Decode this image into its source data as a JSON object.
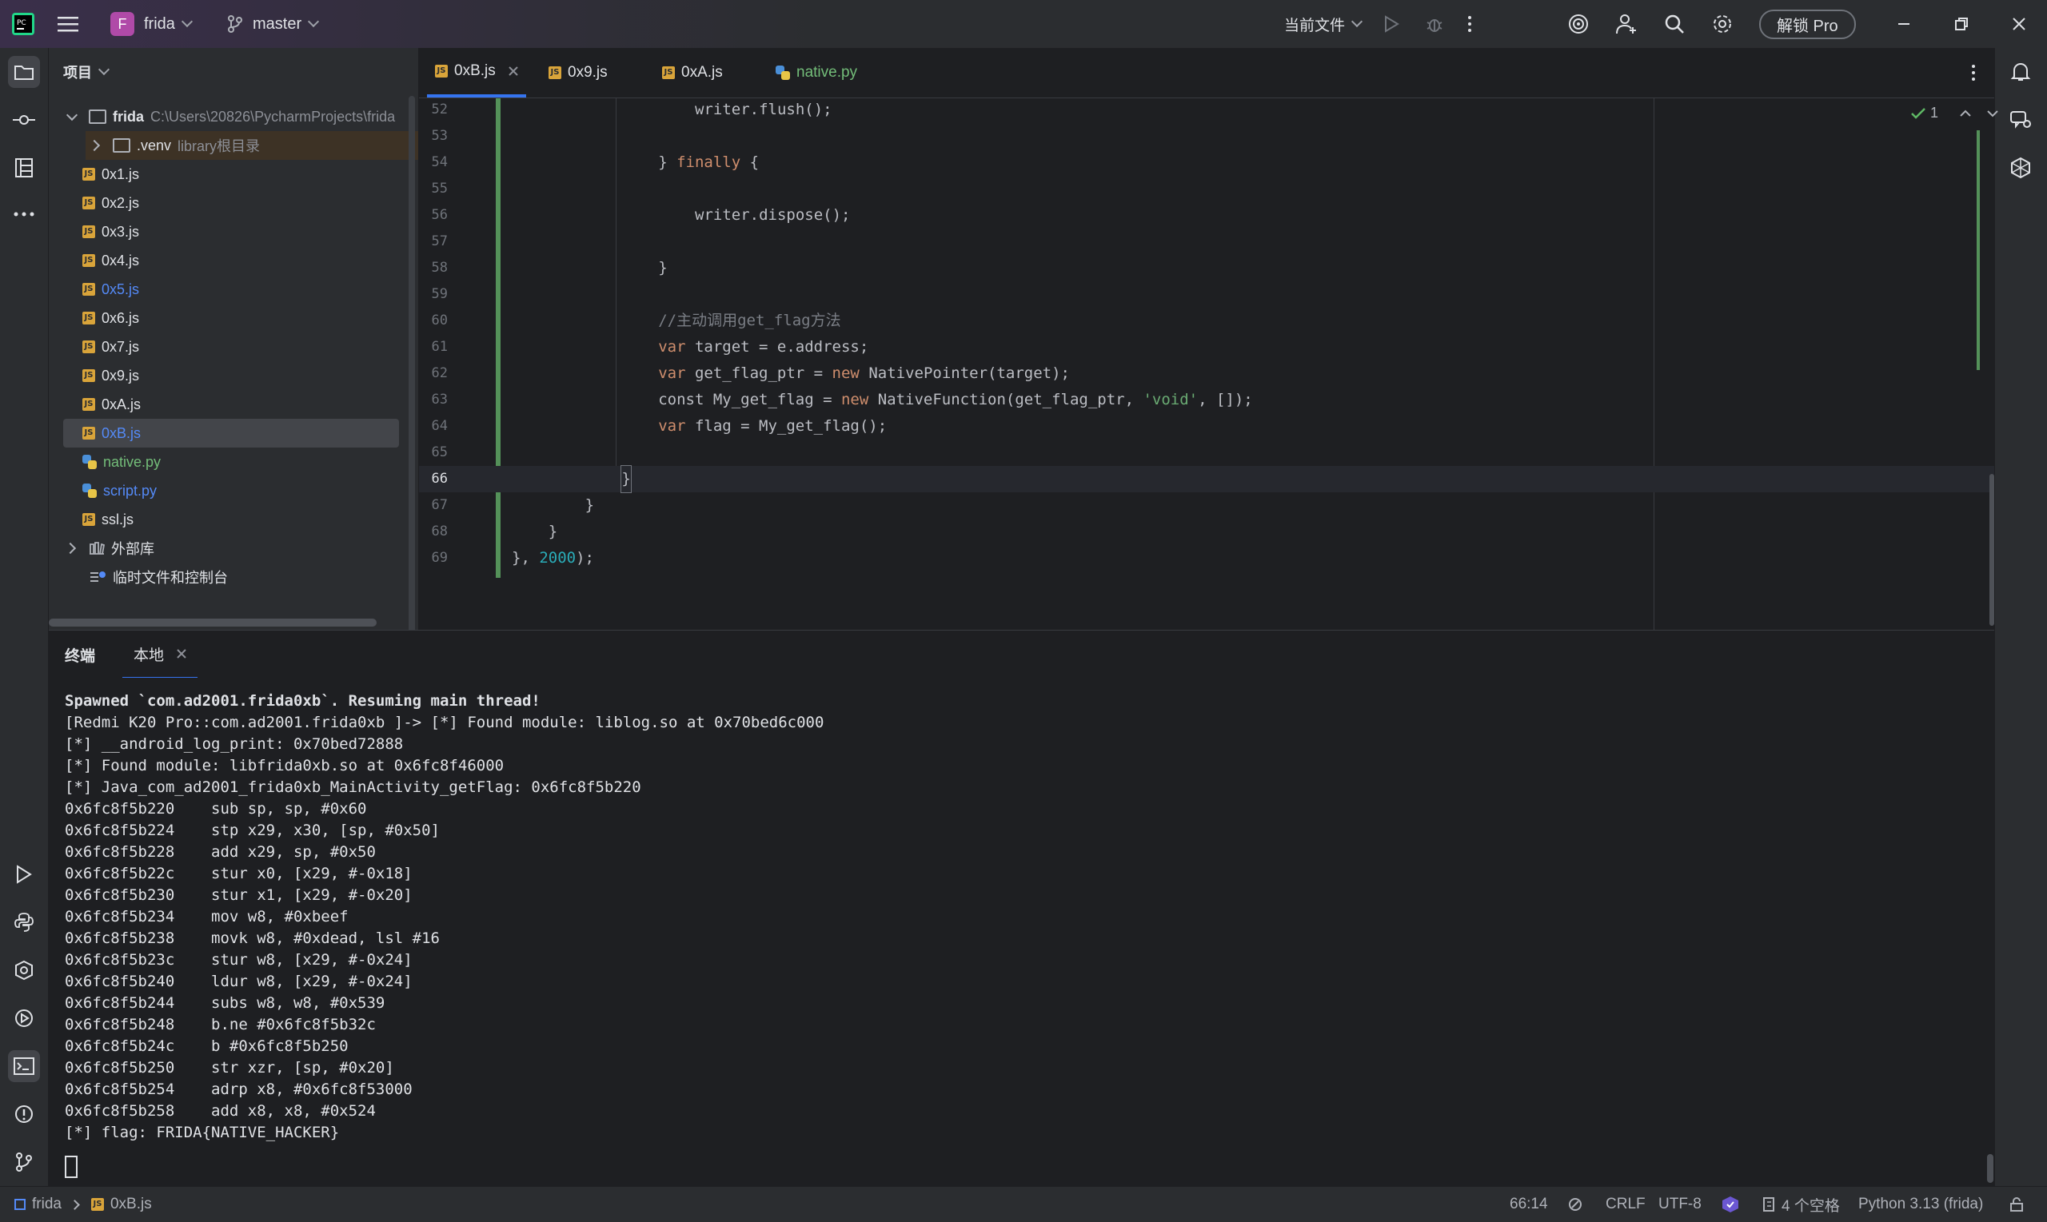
{
  "titlebar": {
    "project_letter": "F",
    "project_name": "frida",
    "branch": "master",
    "run_config": "当前文件",
    "unlock_label": "解锁 Pro"
  },
  "project_panel": {
    "header": "项目",
    "root_name": "frida",
    "root_path": "C:\\Users\\20826\\PycharmProjects\\frida",
    "items": [
      {
        "label": ".venv",
        "hint": "library根目录",
        "type": "folder"
      },
      {
        "label": "0x1.js",
        "type": "js"
      },
      {
        "label": "0x2.js",
        "type": "js"
      },
      {
        "label": "0x3.js",
        "type": "js"
      },
      {
        "label": "0x4.js",
        "type": "js"
      },
      {
        "label": "0x5.js",
        "type": "js",
        "color": "#548af7"
      },
      {
        "label": "0x6.js",
        "type": "js"
      },
      {
        "label": "0x7.js",
        "type": "js"
      },
      {
        "label": "0x9.js",
        "type": "js"
      },
      {
        "label": "0xA.js",
        "type": "js"
      },
      {
        "label": "0xB.js",
        "type": "js",
        "color": "#548af7",
        "selected": true
      },
      {
        "label": "native.py",
        "type": "py",
        "color": "#73bd79"
      },
      {
        "label": "script.py",
        "type": "py",
        "color": "#548af7"
      },
      {
        "label": "ssl.js",
        "type": "js"
      }
    ],
    "external_libs": "外部库",
    "scratches": "临时文件和控制台"
  },
  "editor": {
    "tabs": [
      {
        "label": "0xB.js",
        "active": true,
        "closable": true,
        "icon": "js"
      },
      {
        "label": "0x9.js",
        "icon": "js"
      },
      {
        "label": "0xA.js",
        "icon": "js"
      },
      {
        "label": "native.py",
        "icon": "py",
        "color": "#73bd79"
      }
    ],
    "inspection_count": "1",
    "lines": [
      {
        "n": "52",
        "indent": 20,
        "parts": [
          [
            "writer.flush();",
            ""
          ]
        ]
      },
      {
        "n": "53",
        "indent": 0,
        "parts": []
      },
      {
        "n": "54",
        "indent": 16,
        "parts": [
          [
            "} ",
            ""
          ],
          [
            "finally",
            "kw"
          ],
          [
            " {",
            ""
          ]
        ]
      },
      {
        "n": "55",
        "indent": 0,
        "parts": []
      },
      {
        "n": "56",
        "indent": 20,
        "parts": [
          [
            "writer.dispose();",
            ""
          ]
        ]
      },
      {
        "n": "57",
        "indent": 0,
        "parts": []
      },
      {
        "n": "58",
        "indent": 16,
        "parts": [
          [
            "}",
            ""
          ]
        ]
      },
      {
        "n": "59",
        "indent": 0,
        "parts": []
      },
      {
        "n": "60",
        "indent": 16,
        "parts": [
          [
            "//主动调用get_flag方法",
            "cmt"
          ]
        ]
      },
      {
        "n": "61",
        "indent": 16,
        "parts": [
          [
            "var",
            "kw"
          ],
          [
            " target = e.address;",
            ""
          ]
        ]
      },
      {
        "n": "62",
        "indent": 16,
        "parts": [
          [
            "var",
            "kw"
          ],
          [
            " get_flag_ptr = ",
            ""
          ],
          [
            "new",
            "kw"
          ],
          [
            " NativePointer(target);",
            ""
          ]
        ]
      },
      {
        "n": "63",
        "indent": 16,
        "parts": [
          [
            "const My_get_flag = ",
            ""
          ],
          [
            "new",
            "kw"
          ],
          [
            " NativeFunction(get_flag_ptr, ",
            ""
          ],
          [
            "'void'",
            "str"
          ],
          [
            ", []);",
            ""
          ]
        ]
      },
      {
        "n": "64",
        "indent": 16,
        "parts": [
          [
            "var",
            "kw"
          ],
          [
            " flag = My_get_flag();",
            ""
          ]
        ]
      },
      {
        "n": "65",
        "indent": 0,
        "parts": []
      },
      {
        "n": "66",
        "indent": 12,
        "parts": [
          [
            "}",
            ""
          ]
        ],
        "current": true
      },
      {
        "n": "67",
        "indent": 8,
        "parts": [
          [
            "}",
            ""
          ]
        ]
      },
      {
        "n": "68",
        "indent": 4,
        "parts": [
          [
            "}",
            ""
          ]
        ]
      },
      {
        "n": "69",
        "indent": 0,
        "parts": [
          [
            "}, ",
            ""
          ],
          [
            "2000",
            "num"
          ],
          [
            ");",
            ""
          ]
        ]
      }
    ]
  },
  "terminal": {
    "title": "终端",
    "tab_label": "本地",
    "lines": [
      "Spawned `com.ad2001.frida0xb`. Resuming main thread!",
      "[Redmi K20 Pro::com.ad2001.frida0xb ]-> [*] Found module: liblog.so at 0x70bed6c000",
      "[*] __android_log_print: 0x70bed72888",
      "[*] Found module: libfrida0xb.so at 0x6fc8f46000",
      "[*] Java_com_ad2001_frida0xb_MainActivity_getFlag: 0x6fc8f5b220",
      "0x6fc8f5b220    sub sp, sp, #0x60",
      "0x6fc8f5b224    stp x29, x30, [sp, #0x50]",
      "0x6fc8f5b228    add x29, sp, #0x50",
      "0x6fc8f5b22c    stur x0, [x29, #-0x18]",
      "0x6fc8f5b230    stur x1, [x29, #-0x20]",
      "0x6fc8f5b234    mov w8, #0xbeef",
      "0x6fc8f5b238    movk w8, #0xdead, lsl #16",
      "0x6fc8f5b23c    stur w8, [x29, #-0x24]",
      "0x6fc8f5b240    ldur w8, [x29, #-0x24]",
      "0x6fc8f5b244    subs w8, w8, #0x539",
      "0x6fc8f5b248    b.ne #0x6fc8f5b32c",
      "0x6fc8f5b24c    b #0x6fc8f5b250",
      "0x6fc8f5b250    str xzr, [sp, #0x20]",
      "0x6fc8f5b254    adrp x8, #0x6fc8f53000",
      "0x6fc8f5b258    add x8, x8, #0x524",
      "[*] flag: FRIDA{NATIVE_HACKER}"
    ]
  },
  "statusbar": {
    "breadcrumb_project": "frida",
    "breadcrumb_file": "0xB.js",
    "position": "66:14",
    "line_ending": "CRLF",
    "encoding": "UTF-8",
    "indent": "4 个空格",
    "interpreter": "Python 3.13 (frida)"
  }
}
